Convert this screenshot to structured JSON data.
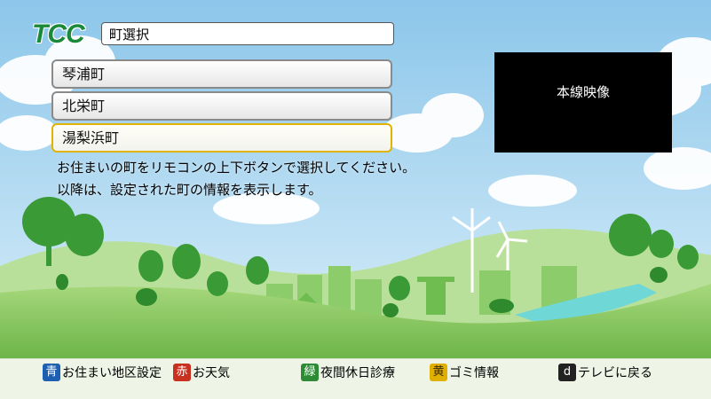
{
  "header": {
    "logo_text": "TCC",
    "title": "町選択"
  },
  "town_list": {
    "items": [
      {
        "label": "琴浦町"
      },
      {
        "label": "北栄町"
      },
      {
        "label": "湯梨浜町"
      }
    ],
    "selected_index": 2
  },
  "instructions": {
    "line1": "お住まいの町をリモコンの上下ボタンで選択してください。",
    "line2": "以降は、設定された町の情報を表示します。"
  },
  "video_box": {
    "label": "本線映像"
  },
  "bottom_bar": {
    "blue": {
      "key": "青",
      "label": "お住まい地区設定"
    },
    "red": {
      "key": "赤",
      "label": "お天気"
    },
    "green": {
      "key": "緑",
      "label": "夜間休日診療"
    },
    "yellow": {
      "key": "黄",
      "label": "ゴミ情報"
    },
    "d": {
      "key": "d",
      "label": "テレビに戻る"
    }
  },
  "colors": {
    "sky": "#9fd0ec",
    "grass": "#7fc45a",
    "bottom_bar": "#eef5e6",
    "selected_border": "#e2b400",
    "blue_key": "#1d5fb0",
    "red_key": "#c8301f",
    "green_key": "#2d8a35",
    "yellow_key": "#e0b000"
  }
}
